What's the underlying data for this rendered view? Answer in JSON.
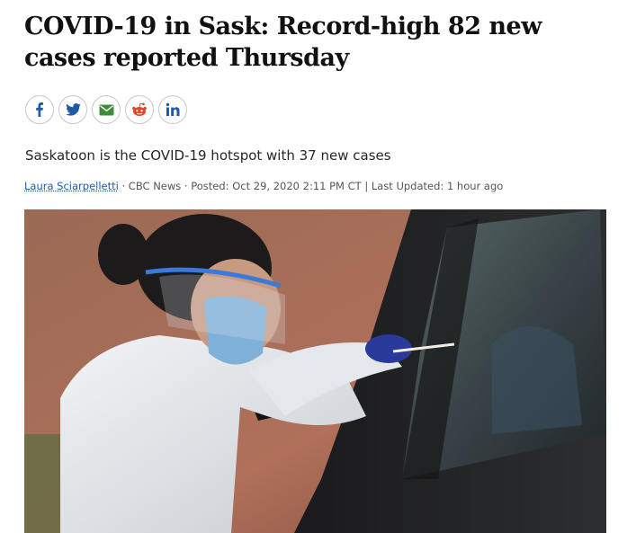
{
  "article": {
    "headline": "COVID-19 in Sask: Record-high 82 new cases reported Thursday",
    "deck": "Saskatoon is the COVID-19 hotspot with 37 new cases",
    "byline": {
      "author": "Laura Sciarpelletti",
      "separator": " · ",
      "source": "CBC News",
      "posted": "Posted: Oct 29, 2020 2:11 PM CT",
      "divider": " | ",
      "updated": "Last Updated: 1 hour ago"
    }
  },
  "share": {
    "buttons": [
      {
        "name": "facebook",
        "icon": "facebook-icon",
        "color": "#1e5aa8"
      },
      {
        "name": "twitter",
        "icon": "twitter-icon",
        "color": "#1e5aa8"
      },
      {
        "name": "email",
        "icon": "email-icon",
        "color": "#3c8c3c"
      },
      {
        "name": "reddit",
        "icon": "reddit-icon",
        "color": "#e0472a"
      },
      {
        "name": "linkedin",
        "icon": "linkedin-icon",
        "color": "#1e5aa8"
      }
    ]
  },
  "colors": {
    "text": "#111111",
    "link": "#1e5aa8",
    "border": "#c8c8c8"
  }
}
